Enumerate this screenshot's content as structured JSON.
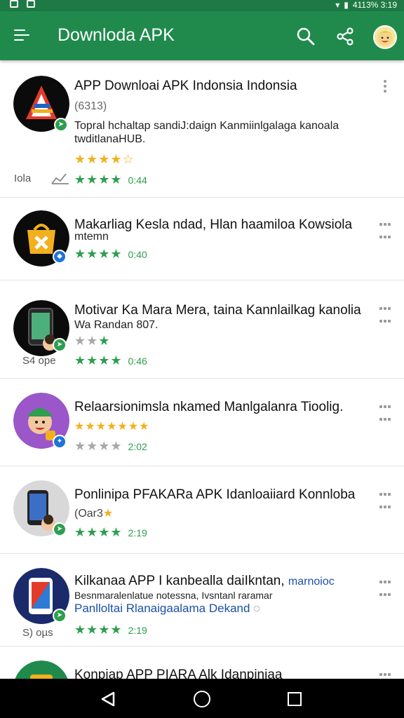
{
  "status_bar": {
    "right_text": "4113% 3:19"
  },
  "app_bar": {
    "title": "Downloda APK"
  },
  "apps": [
    {
      "name": "APP Downloai APK Indonsia Indonsia",
      "meta": "(6313)",
      "desc1": "Topral hchaltap sandiJ:daign Kanmiinlgalaga kanoala",
      "desc2": "twditlanaHUB.",
      "rating": "0:44",
      "side_label": "Iola"
    },
    {
      "name": "Makarliag Kesla ndad, Hlan haamiloa Kowsiola",
      "desc1": "mtemn",
      "rating": "0:40"
    },
    {
      "name": "Motivar Ka Mara Mera, taina Kannlailkag kanolia",
      "desc1": "Wa Randan 807.",
      "rating": "0:46",
      "side_label": "S4 ope"
    },
    {
      "name": "Relaarsionimsla nkamed Manlgalanra Tioolig.",
      "rating": "2:02"
    },
    {
      "name": "Ponlinipa PFAKARa APK Idanloaiiard Konnloba",
      "meta": "(Oar3",
      "rating": "2:19"
    },
    {
      "name": "Kilkanaa APP I kanbealla daiIkntan, ",
      "name_blue": "marnoioc",
      "desc1": "Besnmaralenlatue notessna, Ivsntanl raramar",
      "desc2": "Panlloltai Rlanaigaalama Dekand",
      "rating": "2:19",
      "side_label": "S) oµs"
    },
    {
      "name": "Konpiap APP PIARA Alk Idanpiniaa"
    }
  ]
}
